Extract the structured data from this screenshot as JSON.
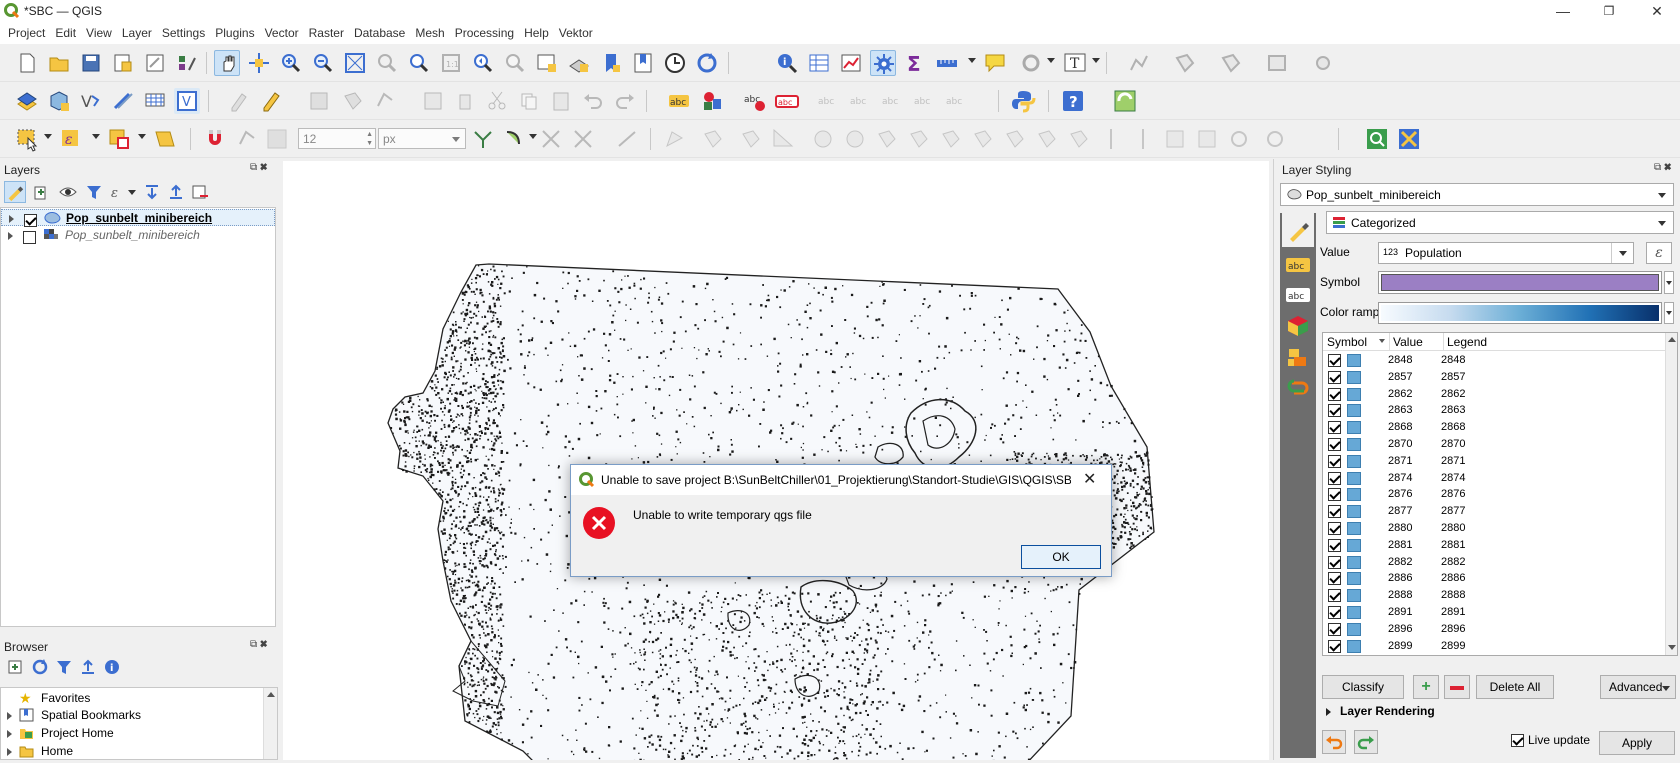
{
  "window": {
    "title": "*SBC — QGIS",
    "minimize": "—",
    "restore": "❐",
    "close": "✕"
  },
  "menu": [
    "Project",
    "Edit",
    "View",
    "Layer",
    "Settings",
    "Plugins",
    "Vector",
    "Raster",
    "Database",
    "Mesh",
    "Processing",
    "Help",
    "Vektor"
  ],
  "digitize": {
    "snap_value": "12",
    "unit": "px"
  },
  "layers_panel": {
    "title": "Layers",
    "items": [
      {
        "label": "Pop_sunbelt_minibereich",
        "checked": true,
        "bold": true
      },
      {
        "label": "Pop_sunbelt_minibereich",
        "checked": false,
        "bold": false
      }
    ]
  },
  "browser_panel": {
    "title": "Browser",
    "items": [
      "Favorites",
      "Spatial Bookmarks",
      "Project Home",
      "Home"
    ]
  },
  "styling": {
    "title": "Layer Styling",
    "layer": "Pop_sunbelt_minibereich",
    "renderer": "Categorized",
    "value_label": "Value",
    "value_prefix": "123",
    "value": "Population",
    "symbol_label": "Symbol",
    "symbol_color": "#9b7fc4",
    "ramp_label": "Color ramp",
    "headers": {
      "symbol": "Symbol",
      "value": "Value",
      "legend": "Legend"
    },
    "rows": [
      {
        "value": "2848",
        "legend": "2848"
      },
      {
        "value": "2857",
        "legend": "2857"
      },
      {
        "value": "2862",
        "legend": "2862"
      },
      {
        "value": "2863",
        "legend": "2863"
      },
      {
        "value": "2868",
        "legend": "2868"
      },
      {
        "value": "2870",
        "legend": "2870"
      },
      {
        "value": "2871",
        "legend": "2871"
      },
      {
        "value": "2874",
        "legend": "2874"
      },
      {
        "value": "2876",
        "legend": "2876"
      },
      {
        "value": "2877",
        "legend": "2877"
      },
      {
        "value": "2880",
        "legend": "2880"
      },
      {
        "value": "2881",
        "legend": "2881"
      },
      {
        "value": "2882",
        "legend": "2882"
      },
      {
        "value": "2886",
        "legend": "2886"
      },
      {
        "value": "2888",
        "legend": "2888"
      },
      {
        "value": "2891",
        "legend": "2891"
      },
      {
        "value": "2896",
        "legend": "2896"
      },
      {
        "value": "2899",
        "legend": "2899"
      }
    ],
    "classify": "Classify",
    "delete_all": "Delete All",
    "advanced": "Advanced",
    "layer_rendering": "Layer Rendering",
    "live_update": "Live update",
    "apply": "Apply"
  },
  "dialog": {
    "title": "Unable to save project B:\\SunBeltChiller\\01_Projektierung\\Standort-Studie\\GIS\\QGIS\\SBC...",
    "message": "Unable to write temporary qgs file",
    "ok": "OK"
  },
  "colors": {
    "accent": "#0b4f9e",
    "error": "#e81123",
    "swatch": "#66a8d6"
  }
}
